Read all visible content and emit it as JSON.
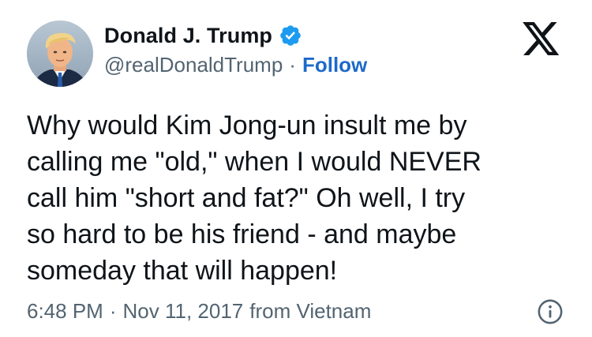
{
  "author": {
    "display_name": "Donald J. Trump",
    "handle": "@realDonaldTrump",
    "separator": "·",
    "follow_label": "Follow",
    "verified_color": "#1d9bf0"
  },
  "tweet": {
    "lines": [
      "Why would Kim Jong-un insult me by",
      "calling me \"old,\" when I would NEVER",
      "call him \"short and fat?\" Oh well, I try",
      "so hard to be his friend - and maybe",
      "someday that will happen!"
    ]
  },
  "meta": {
    "time": "6:48 PM",
    "separator": "·",
    "date": "Nov 11, 2017",
    "source": "from Vietnam"
  },
  "icons": {
    "brand": "x-logo-icon",
    "verified": "verified-badge-icon",
    "info": "info-icon"
  },
  "colors": {
    "text": "#0f1419",
    "secondary": "#536471",
    "link": "#1d6ac9"
  }
}
